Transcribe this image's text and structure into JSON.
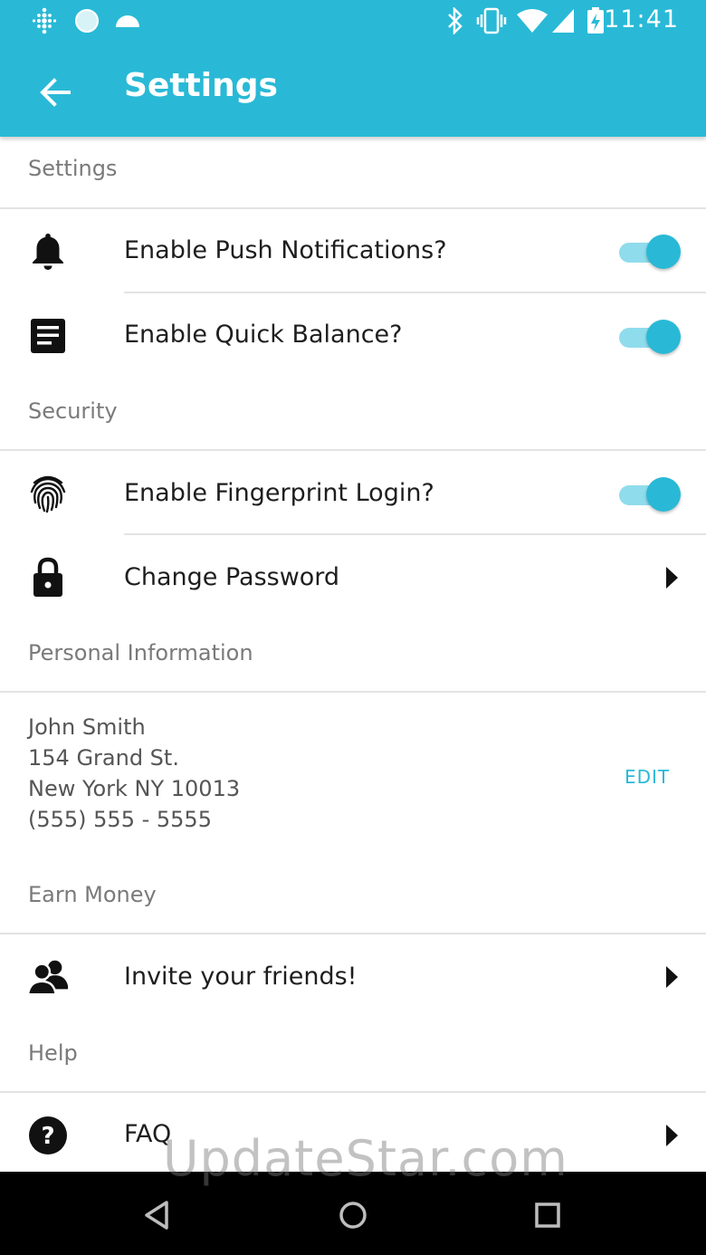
{
  "status_bar": {
    "time": "11:41"
  },
  "app_bar": {
    "title": "Settings"
  },
  "sections": {
    "settings": "Settings",
    "security": "Security",
    "personal": "Personal Information",
    "earn": "Earn Money",
    "help": "Help"
  },
  "rows": {
    "push": {
      "label": "Enable Push Notifications?",
      "enabled": true
    },
    "quick_balance": {
      "label": "Enable Quick Balance?",
      "enabled": true
    },
    "fingerprint": {
      "label": "Enable Fingerprint Login?",
      "enabled": true
    },
    "change_password": {
      "label": "Change Password"
    },
    "invite": {
      "label": "Invite your friends!"
    },
    "faq": {
      "label": "FAQ"
    }
  },
  "personal_info": {
    "name": "John Smith",
    "street": "154 Grand St.",
    "city": "New York NY 10013",
    "phone": "(555) 555 - 5555",
    "edit_label": "EDIT"
  },
  "watermark": "UpdateStar.com",
  "colors": {
    "accent": "#29b9d6",
    "toggle_track": "#8fdcec"
  }
}
